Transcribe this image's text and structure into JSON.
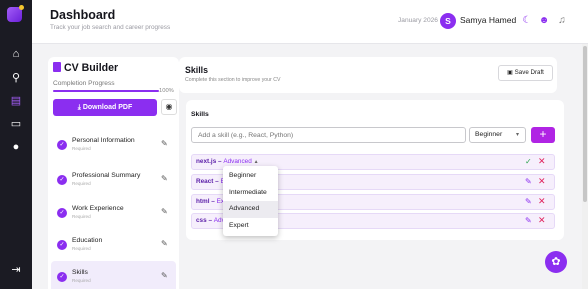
{
  "app": {
    "title": "Dashboard",
    "subtitle": "Track your job search and career progress",
    "date": "January 2026",
    "user": {
      "initial": "S",
      "name": "Samya Hamed"
    },
    "accent": "#8b2ef0"
  },
  "rail": {
    "icons": [
      "home-icon",
      "search-icon",
      "document-icon",
      "chat-icon",
      "user-icon",
      "logout-icon"
    ],
    "active": "document-icon"
  },
  "header_icons": [
    "moon-icon",
    "robot-icon",
    "bell-icon"
  ],
  "builder": {
    "title": "CV Builder",
    "progress_label": "Completion Progress",
    "progress_value": 1.0,
    "progress_text": "100%",
    "download_label": "Download PDF",
    "sections": [
      {
        "label": "Personal Information",
        "status": "Required"
      },
      {
        "label": "Professional Summary",
        "status": "Required"
      },
      {
        "label": "Work Experience",
        "status": "Required"
      },
      {
        "label": "Education",
        "status": "Required"
      },
      {
        "label": "Skills",
        "status": "Required",
        "selected": true
      }
    ]
  },
  "skills_panel": {
    "title": "Skills",
    "subtitle": "Complete this section to improve your CV",
    "save_draft": "Save Draft",
    "section_label": "Skills",
    "input_placeholder": "Add a skill (e.g., React, Python)",
    "level_selected": "Beginner",
    "rows": [
      {
        "name": "next.js",
        "sep": " – ",
        "level": "Advanced",
        "editing": true
      },
      {
        "name": "React",
        "sep": " – ",
        "level": "Ex"
      },
      {
        "name": "html",
        "sep": " – ",
        "level": "Ex"
      },
      {
        "name": "css",
        "sep": " – ",
        "level": "Adv"
      }
    ],
    "dropdown_options": [
      "Beginner",
      "Intermediate",
      "Advanced",
      "Expert"
    ],
    "dropdown_highlight": "Advanced"
  }
}
